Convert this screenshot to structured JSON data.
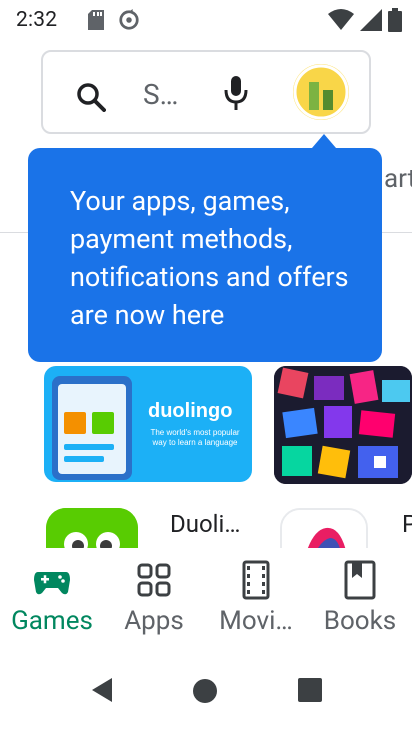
{
  "status_bar": {
    "time": "2:32",
    "icons": [
      "sd-card-icon",
      "sync-icon",
      "wifi-icon",
      "signal-icon",
      "battery-icon"
    ]
  },
  "search": {
    "placeholder": "S…",
    "icon": "search-icon",
    "voice_icon": "mic-icon"
  },
  "tabs_peek": {
    "label": "art"
  },
  "tooltip": {
    "text": "Your apps, games, payment methods, notifications and offers are now here"
  },
  "featured": {
    "duolingo": {
      "title": "duolingo",
      "subtitle": "The world's most popular way to learn a language"
    }
  },
  "apps_row": [
    {
      "name": "Duoli…"
    },
    {
      "name": "P"
    }
  ],
  "bottom_nav": {
    "items": [
      {
        "label": "Games",
        "icon": "gamepad-icon",
        "active": true
      },
      {
        "label": "Apps",
        "icon": "apps-grid-icon",
        "active": false
      },
      {
        "label": "Movi…",
        "icon": "movie-icon",
        "active": false
      },
      {
        "label": "Books",
        "icon": "book-icon",
        "active": false
      }
    ]
  },
  "colors": {
    "accent": "#01875f",
    "tooltip": "#1a73e8",
    "text": "#202124",
    "muted": "#5f6368"
  }
}
